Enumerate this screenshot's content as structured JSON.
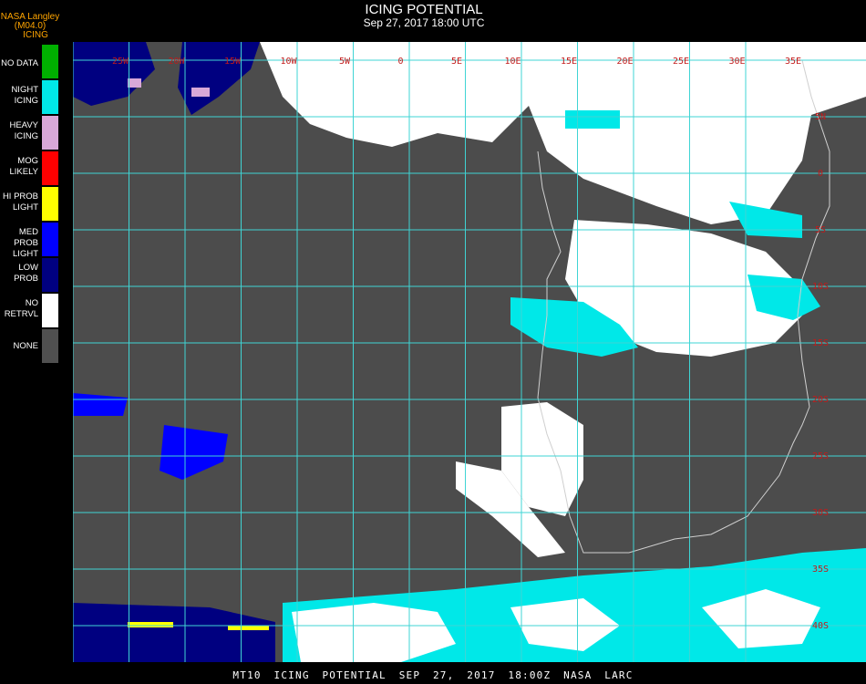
{
  "header": {
    "source": "NASA Langley (M04.0)",
    "product": "ICING",
    "title": "ICING POTENTIAL",
    "datetime": "Sep 27, 2017 18:00 UTC"
  },
  "legend": [
    {
      "label": "NO DATA",
      "color": "#00b000"
    },
    {
      "label": "NIGHT ICING",
      "color": "#00e8e8"
    },
    {
      "label": "HEAVY ICING",
      "color": "#d8a8d8"
    },
    {
      "label": "MOG LIKELY",
      "color": "#ff0000"
    },
    {
      "label": "HI PROB LIGHT",
      "color": "#ffff00"
    },
    {
      "label": "MED PROB LIGHT",
      "color": "#0000ff"
    },
    {
      "label": "LOW PROB",
      "color": "#000080"
    },
    {
      "label": "NO RETRVL",
      "color": "#ffffff"
    },
    {
      "label": "NONE",
      "color": "#505050"
    }
  ],
  "map": {
    "background_color": "#4c4c4c",
    "grid_color": "#3fd4d4",
    "label_color": "#c21b1b",
    "lon_labels": [
      "25W",
      "20W",
      "15W",
      "10W",
      "5W",
      "0",
      "5E",
      "10E",
      "15E",
      "20E",
      "25E",
      "30E",
      "35E"
    ],
    "lat_labels": [
      "5N",
      "0",
      "5S",
      "10S",
      "15S",
      "20S",
      "25S",
      "30S",
      "35S",
      "40S"
    ]
  },
  "footer": {
    "text": "MT10  ICING POTENTIAL   SEP 27, 2017 18:00Z   NASA LARC"
  }
}
